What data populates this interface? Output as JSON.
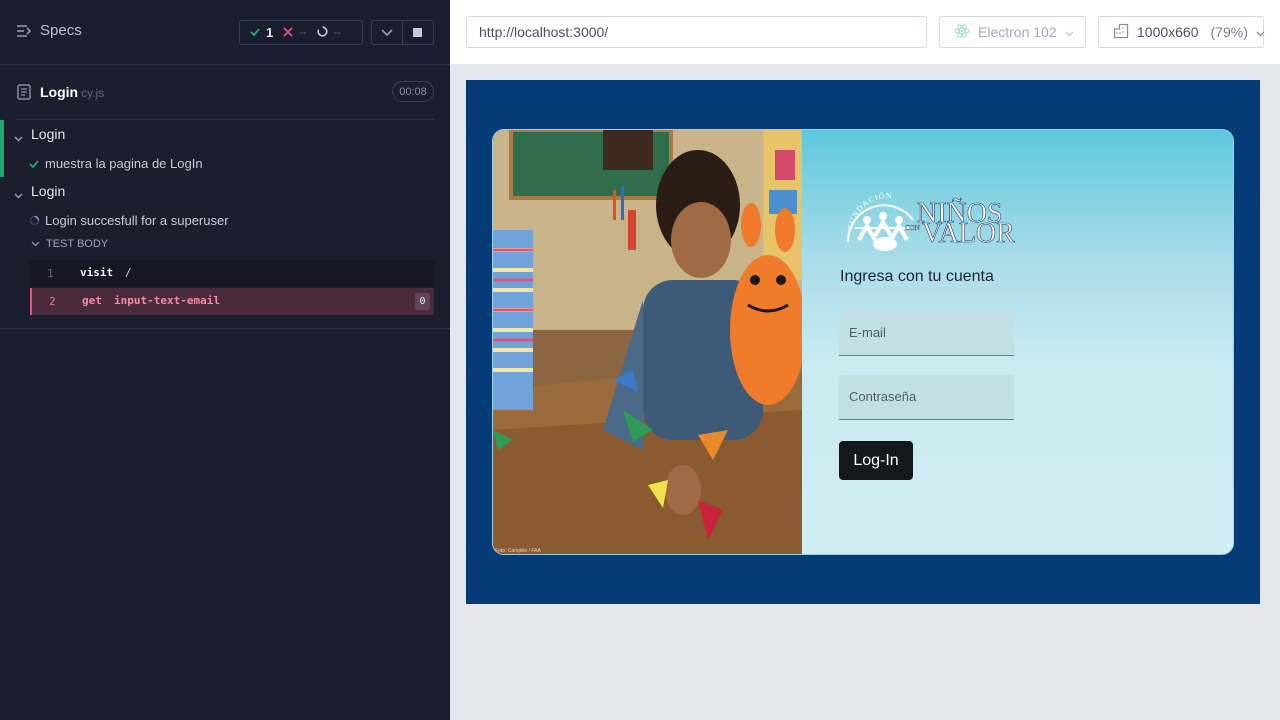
{
  "reporter": {
    "specs_label": "Specs",
    "stats": {
      "passed": "1",
      "failed": "--",
      "pending": "--"
    },
    "spec": {
      "name": "Login",
      "ext": "cy.js",
      "duration": "00:08"
    },
    "suites": [
      {
        "title": "Login",
        "tests": [
          {
            "title": "muestra la pagina de LogIn",
            "state": "passed"
          }
        ]
      },
      {
        "title": "Login",
        "tests": [
          {
            "title": "Login succesfull for a superuser",
            "state": "running"
          }
        ]
      }
    ],
    "test_body_label": "TEST BODY",
    "commands": [
      {
        "num": "1",
        "name": "visit",
        "message": "/",
        "state": "passed"
      },
      {
        "num": "2",
        "name": "get",
        "message": "input-text-email",
        "count": "0",
        "state": "failed"
      }
    ],
    "colors": {
      "passed": "#1fa971",
      "failed": "#e4577a",
      "background": "#1b1e2e"
    }
  },
  "aut": {
    "url": "http://localhost:3000/",
    "browser": "Electron 102",
    "viewport": "1000x660",
    "scale": "(79%)",
    "page": {
      "logo_icon": "fundacion-ninos-con-valor-logo",
      "logo_text": {
        "arc": "FUNDACIÓN",
        "top": "NIÑOS",
        "small": "CON",
        "bottom": "VALOR"
      },
      "photo_credit": "Foto: Campillo / FAA",
      "title": "Ingresa con tu cuenta",
      "email_placeholder": "E-mail",
      "password_placeholder": "Contraseña",
      "login_button": "Log-In"
    },
    "colors": {
      "frame_bg": "#053c78",
      "button_bg": "#15191c"
    }
  }
}
